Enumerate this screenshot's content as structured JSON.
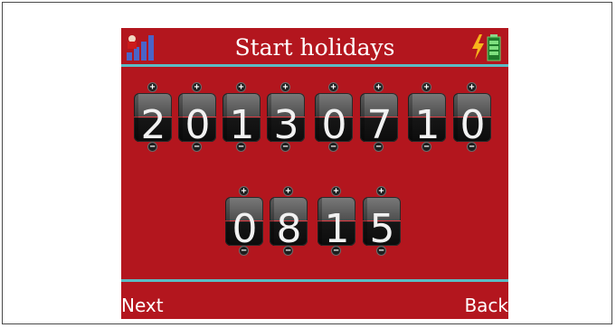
{
  "screen": {
    "title": "Start holidays",
    "icons": {
      "left": "signal-strength-icon",
      "right": "battery-charging-icon"
    }
  },
  "date_digits": [
    "2",
    "0",
    "1",
    "3",
    "0",
    "7",
    "1",
    "0"
  ],
  "time_digits": [
    "0",
    "8",
    "1",
    "5"
  ],
  "buttons": {
    "increment": "+",
    "decrement": "−"
  },
  "softkeys": {
    "left": "Next",
    "right": "Back"
  },
  "colors": {
    "background": "#b3161e",
    "separator": "#5bbcc4",
    "text": "#ffffff"
  }
}
